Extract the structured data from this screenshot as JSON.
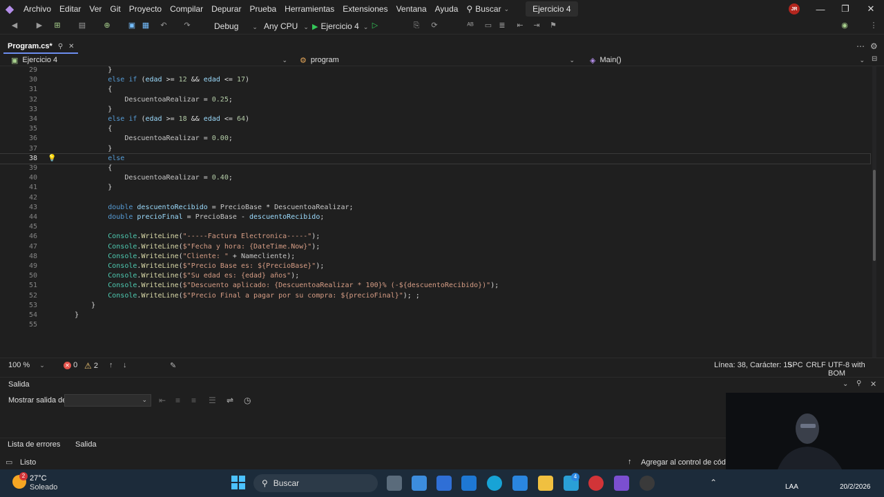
{
  "menu": {
    "items": [
      "Archivo",
      "Editar",
      "Ver",
      "Git",
      "Proyecto",
      "Compilar",
      "Depurar",
      "Prueba",
      "Herramientas",
      "Extensiones",
      "Ventana",
      "Ayuda"
    ],
    "search": "Buscar",
    "solution_title": "Ejercicio 4",
    "avatar_initials": "JR"
  },
  "toolbar": {
    "configuration": "Debug",
    "platform": "Any CPU",
    "run_label": "Ejercicio 4"
  },
  "tab": {
    "title": "Program.cs*"
  },
  "navbar": {
    "project": "Ejercicio 4",
    "type": "program",
    "member": "Main()"
  },
  "editor": {
    "current_line": "38",
    "lines": [
      {
        "n": "29",
        "t": "            }"
      },
      {
        "n": "30",
        "t": "            else if (edad >= 12 && edad <= 17)"
      },
      {
        "n": "31",
        "t": "            {"
      },
      {
        "n": "32",
        "t": "                DescuentoaRealizar = 0.25;"
      },
      {
        "n": "33",
        "t": "            }"
      },
      {
        "n": "34",
        "t": "            else if (edad >= 18 && edad <= 64)"
      },
      {
        "n": "35",
        "t": "            {"
      },
      {
        "n": "36",
        "t": "                DescuentoaRealizar = 0.00;"
      },
      {
        "n": "37",
        "t": "            }"
      },
      {
        "n": "38",
        "t": "            else"
      },
      {
        "n": "39",
        "t": "            {"
      },
      {
        "n": "40",
        "t": "                DescuentoaRealizar = 0.40;"
      },
      {
        "n": "41",
        "t": "            }"
      },
      {
        "n": "42",
        "t": ""
      },
      {
        "n": "43",
        "t": "            double descuentoRecibido = PrecioBase * DescuentoaRealizar;"
      },
      {
        "n": "44",
        "t": "            double precioFinal = PrecioBase - descuentoRecibido;"
      },
      {
        "n": "45",
        "t": ""
      },
      {
        "n": "46",
        "t": "            Console.WriteLine(\"-----Factura Electronica-----\");"
      },
      {
        "n": "47",
        "t": "            Console.WriteLine($\"Fecha y hora: {DateTime.Now}\");"
      },
      {
        "n": "48",
        "t": "            Console.WriteLine(\"Cliente: \" + Namecliente);"
      },
      {
        "n": "49",
        "t": "            Console.WriteLine($\"Precio Base es: ${PrecioBase}\");"
      },
      {
        "n": "50",
        "t": "            Console.WriteLine($\"Su edad es: {edad} años\");"
      },
      {
        "n": "51",
        "t": "            Console.WriteLine($\"Descuento aplicado: {DescuentoaRealizar * 100}% (-${descuentoRecibido})\");"
      },
      {
        "n": "52",
        "t": "            Console.WriteLine($\"Precio Final a pagar por su compra: ${precioFinal}\"); ;"
      },
      {
        "n": "53",
        "t": "        }"
      },
      {
        "n": "54",
        "t": "    }"
      },
      {
        "n": "55",
        "t": ""
      }
    ]
  },
  "editor_status": {
    "zoom": "100 %",
    "errors": "0",
    "warnings": "2",
    "position": "Línea: 38, Carácter: 15",
    "whitespace": "SPC",
    "line_endings": "CRLF",
    "encoding": "UTF-8 with BOM"
  },
  "output": {
    "title": "Salida",
    "show_from_label": "Mostrar salida de:"
  },
  "bottom_tabs": [
    "Lista de errores",
    "Salida"
  ],
  "status": {
    "ready": "Listo",
    "source_control": "Agregar al control de códig"
  },
  "taskbar": {
    "weather_badge": "2",
    "temperature": "27°C",
    "condition": "Soleado",
    "search": "Buscar",
    "lang": "LAA",
    "date": "20/2/2026",
    "notif_badge": "4"
  }
}
